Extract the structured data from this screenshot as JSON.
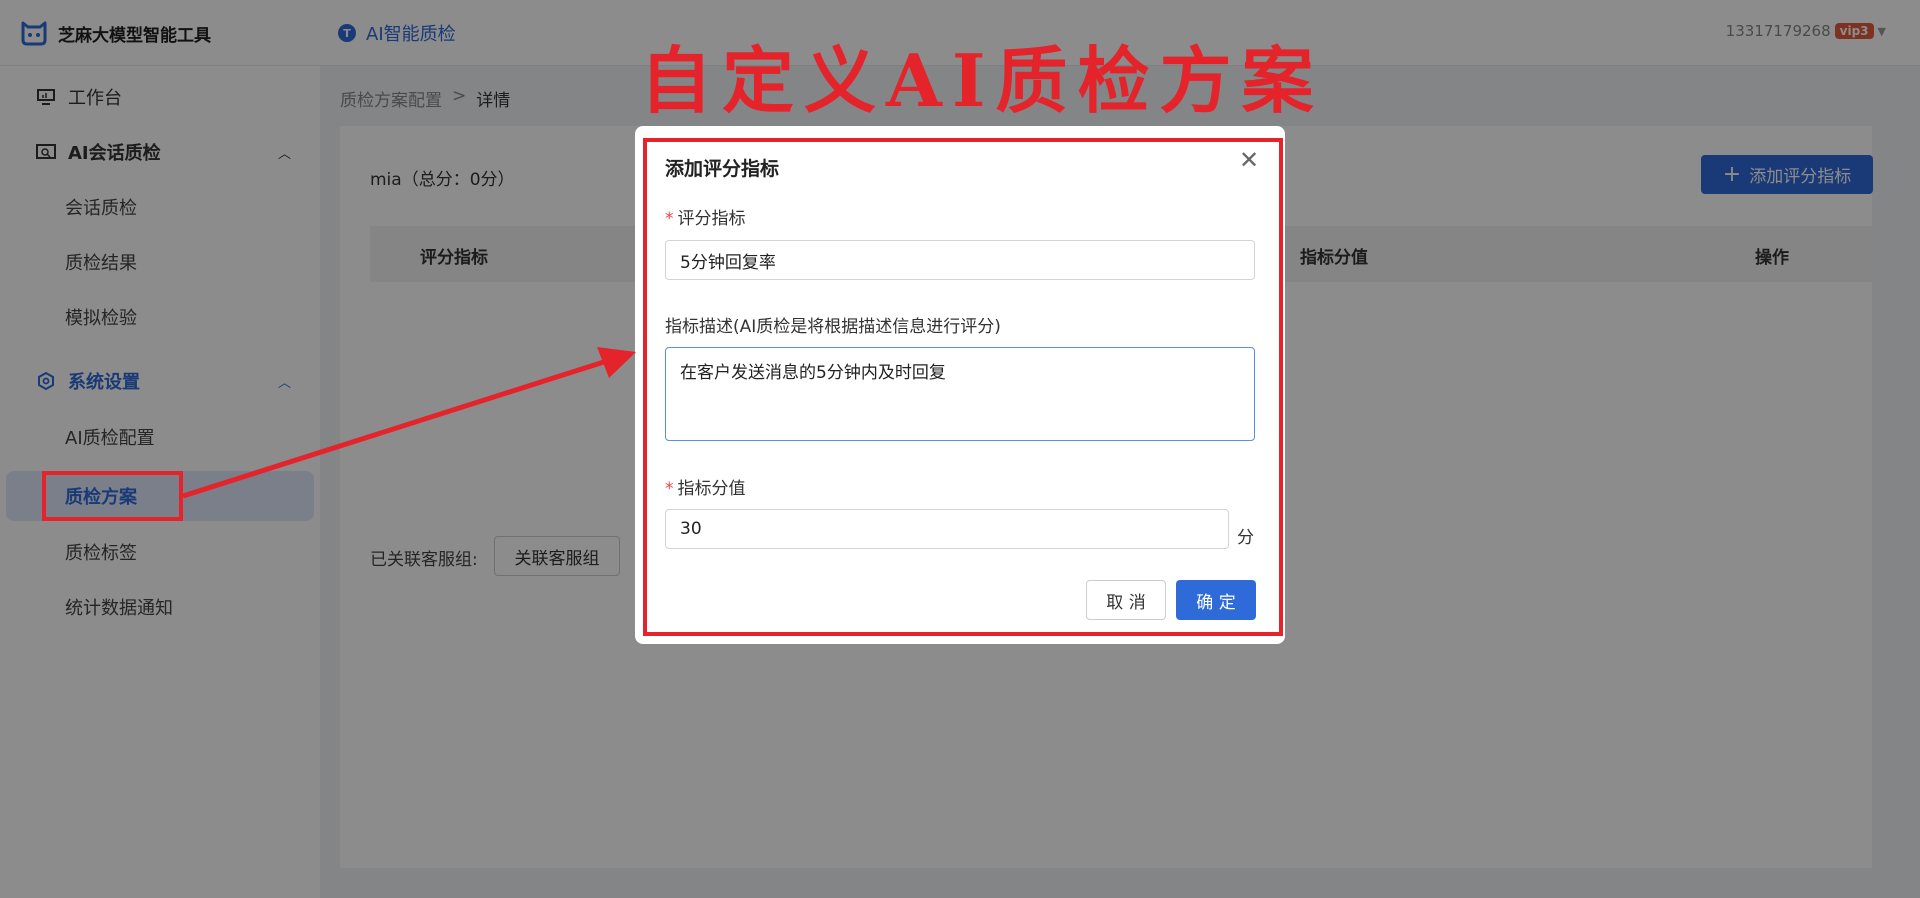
{
  "header": {
    "brand": "芝麻大模型智能工具",
    "app_name": "AI智能质检",
    "app_icon_letter": "T",
    "user_phone": "13317179268",
    "vip_label": "vip",
    "vip_level": "3"
  },
  "sidebar": {
    "workbench": "工作台",
    "group1": {
      "label": "AI会话质检",
      "items": [
        "会话质检",
        "质检结果",
        "模拟检验"
      ]
    },
    "group2": {
      "label": "系统设置",
      "items": [
        "AI质检配置",
        "质检方案",
        "质检标签",
        "统计数据通知"
      ]
    },
    "active_item": "质检方案"
  },
  "breadcrumb": {
    "parent": "质检方案配置",
    "separator": ">",
    "current": "详情"
  },
  "main": {
    "plan_title": "mia（总分：0分）",
    "add_button": "添加评分指标",
    "table_headers": [
      "评分指标",
      "指标分值",
      "操作"
    ],
    "group_label": "已关联客服组:",
    "group_button": "关联客服组"
  },
  "modal": {
    "title": "添加评分指标",
    "field1_label": "评分指标",
    "field1_value": "5分钟回复率",
    "field2_label": "指标描述(AI质检是将根据描述信息进行评分)",
    "field2_value": "在客户发送消息的5分钟内及时回复",
    "field3_label": "指标分值",
    "field3_value": "30",
    "unit": "分",
    "cancel": "取 消",
    "ok": "确 定"
  },
  "annotation": {
    "title": "自定义AI质检方案",
    "color": "#e5232b"
  },
  "colors": {
    "primary": "#2f6bd8",
    "annotation_red": "#e5232b"
  }
}
